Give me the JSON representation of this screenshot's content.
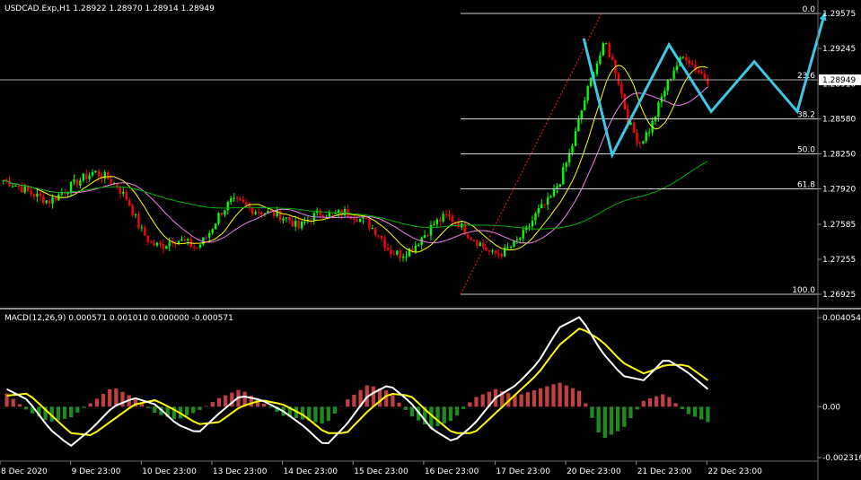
{
  "window": {
    "symbol_header": "USDCAD.Exp,H1  1.28922 1.28970 1.28914 1.28949"
  },
  "chart_data": [
    {
      "type": "candlestick",
      "title": "USDCAD.Exp,H1  1.28922 1.28970 1.28914 1.28949",
      "ylim": [
        1.2873,
        1.2962
      ],
      "y_ticks": [
        "1.29575",
        "1.29245",
        "1.28910",
        "1.28580",
        "1.28250",
        "1.27920",
        "1.27585",
        "1.27255",
        "1.26925"
      ],
      "y_tick_values": [
        1.29575,
        1.29245,
        1.2891,
        1.2858,
        1.2825,
        1.2792,
        1.27585,
        1.27255,
        1.26925
      ],
      "current_price": "1.28949",
      "current_price_value": 1.28949,
      "close_path": [
        1.28,
        1.2796,
        1.279,
        1.2785,
        1.278,
        1.2787,
        1.2795,
        1.2802,
        1.2808,
        1.2803,
        1.2795,
        1.278,
        1.2755,
        1.274,
        1.2738,
        1.2745,
        1.2742,
        1.2736,
        1.2748,
        1.2768,
        1.278,
        1.2778,
        1.2772,
        1.277,
        1.2768,
        1.2764,
        1.2755,
        1.2765,
        1.277,
        1.2767,
        1.277,
        1.2766,
        1.276,
        1.275,
        1.2733,
        1.273,
        1.2736,
        1.2748,
        1.276,
        1.2766,
        1.276,
        1.2748,
        1.274,
        1.273,
        1.2732,
        1.274,
        1.2752,
        1.277,
        1.278,
        1.28,
        1.283,
        1.287,
        1.2905,
        1.293,
        1.29,
        1.2855,
        1.2835,
        1.285,
        1.288,
        1.2905,
        1.2918,
        1.2905,
        1.2895
      ],
      "moving_averages": [
        {
          "color": "#ffff00",
          "period_points": 3
        },
        {
          "color": "#ee82ee",
          "period_points": 6
        },
        {
          "color": "#00b000",
          "period_points": 26
        }
      ],
      "fibonacci": {
        "levels": [
          {
            "label": "0.0",
            "value": 1.29575
          },
          {
            "label": "23.6",
            "value": 1.28949
          },
          {
            "label": "38.2",
            "value": 1.2858
          },
          {
            "label": "50.0",
            "value": 1.2825
          },
          {
            "label": "61.8",
            "value": 1.2792
          },
          {
            "label": "100.0",
            "value": 1.26925
          }
        ]
      },
      "horizontal_line": 1.28949,
      "projection_path": [
        [
          0.678,
          1.2934
        ],
        [
          0.711,
          1.2824
        ],
        [
          0.777,
          1.2928
        ],
        [
          0.826,
          1.2865
        ],
        [
          0.876,
          1.2912
        ],
        [
          0.926,
          1.2865
        ],
        [
          0.958,
          1.2958
        ]
      ]
    },
    {
      "type": "histogram+line",
      "title": "MACD(12,26,9) 0.000571 0.001010 0.000000 -0.000571",
      "ylim": [
        -0.0023,
        0.0041
      ],
      "y_ticks": [
        "0.004054",
        "0.00",
        "-0.002316"
      ],
      "y_tick_values": [
        0.004054,
        0.0,
        -0.002316
      ],
      "macd_path": [
        0.0008,
        0.0003,
        -0.001,
        -0.0018,
        -0.001,
        0.0,
        0.0004,
        0.0001,
        -0.0008,
        -0.0012,
        -0.0003,
        0.0005,
        0.0003,
        -0.0002,
        -0.0009,
        -0.0018,
        -0.0008,
        0.0005,
        0.001,
        0.0002,
        -0.001,
        -0.0016,
        -0.0008,
        0.0004,
        0.001,
        0.002,
        0.0036,
        0.0041,
        0.0025,
        0.0014,
        0.0012,
        0.0022,
        0.0016,
        0.0008
      ],
      "signal_path": [
        0.0005,
        0.0006,
        -0.0003,
        -0.0012,
        -0.0013,
        -0.0006,
        0.0001,
        0.0003,
        -0.0002,
        -0.0008,
        -0.0007,
        0.0,
        0.0003,
        0.0001,
        -0.0004,
        -0.0012,
        -0.0012,
        -0.0002,
        0.0006,
        0.0005,
        -0.0004,
        -0.0012,
        -0.0012,
        -0.0003,
        0.0006,
        0.0015,
        0.0028,
        0.0036,
        0.003,
        0.002,
        0.0015,
        0.0019,
        0.0019,
        0.0012
      ],
      "histogram_path": [
        0.0006,
        -0.0002,
        -0.0007,
        -0.0005,
        0.0002,
        0.0009,
        0.0004,
        -0.0003,
        -0.0006,
        -0.0002,
        0.0004,
        0.0008,
        0.0002,
        -0.0004,
        -0.0006,
        -0.0008,
        0.0003,
        0.001,
        0.0007,
        -0.0004,
        -0.001,
        -0.0006,
        0.0004,
        0.0008,
        0.0005,
        0.0008,
        0.0011,
        0.0007,
        -0.0015,
        -0.001,
        0.0003,
        0.0006,
        -0.0003,
        -0.0007
      ],
      "macd_color": "#ffffff",
      "signal_color": "#ffff00",
      "hist_up_color": "#c04040",
      "hist_down_color": "#1f8a1f"
    }
  ],
  "x_axis": {
    "labels": [
      "8 Dec 2020",
      "9 Dec 23:00",
      "10 Dec 23:00",
      "13 Dec 23:00",
      "14 Dec 23:00",
      "15 Dec 23:00",
      "16 Dec 23:00",
      "17 Dec 23:00",
      "20 Dec 23:00",
      "21 Dec 23:00",
      "22 Dec 23:00"
    ],
    "label_fractions": [
      0.0,
      0.082,
      0.164,
      0.246,
      0.328,
      0.41,
      0.492,
      0.575,
      0.657,
      0.739,
      0.821
    ]
  },
  "colors": {
    "background": "#000000",
    "bull": "#00ff00",
    "bear": "#ff0000",
    "axis_text": "#ffffff",
    "grid_line": "#808080",
    "projection": "#3cc8e6"
  }
}
